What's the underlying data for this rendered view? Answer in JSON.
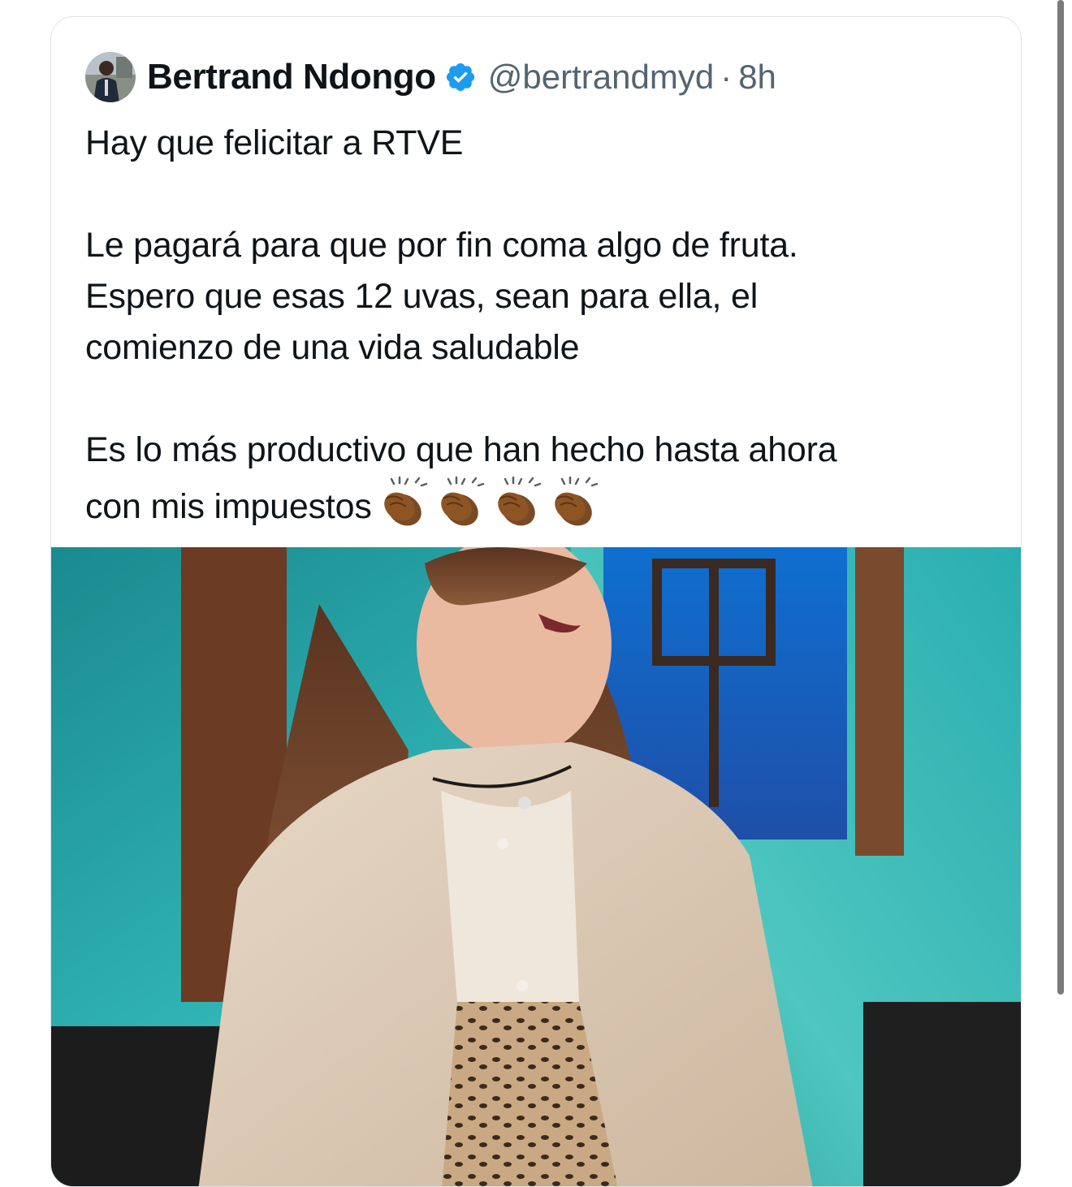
{
  "tweet": {
    "author_name": "Bertrand Ndongo",
    "verified_icon": "verified-badge-icon",
    "handle": "@bertrandmyd",
    "separator": "·",
    "time": "8h",
    "paragraphs": [
      "Hay que felicitar a RTVE",
      "Le pagará para que por fin coma algo de fruta.",
      "Espero que esas 12 uvas, sean para ella, el",
      "comienzo de una vida saludable",
      "Es lo más productivo que han hecho hasta ahora",
      "con mis impuestos"
    ],
    "emoji_icons": [
      "clapping-hands-icon",
      "clapping-hands-icon",
      "clapping-hands-icon",
      "clapping-hands-icon"
    ]
  },
  "colors": {
    "text_primary": "#0f1419",
    "text_secondary": "#536471",
    "verified_blue": "#1d9bf0",
    "card_border": "#dfe3e7",
    "clap_skin": "#8d5524"
  }
}
